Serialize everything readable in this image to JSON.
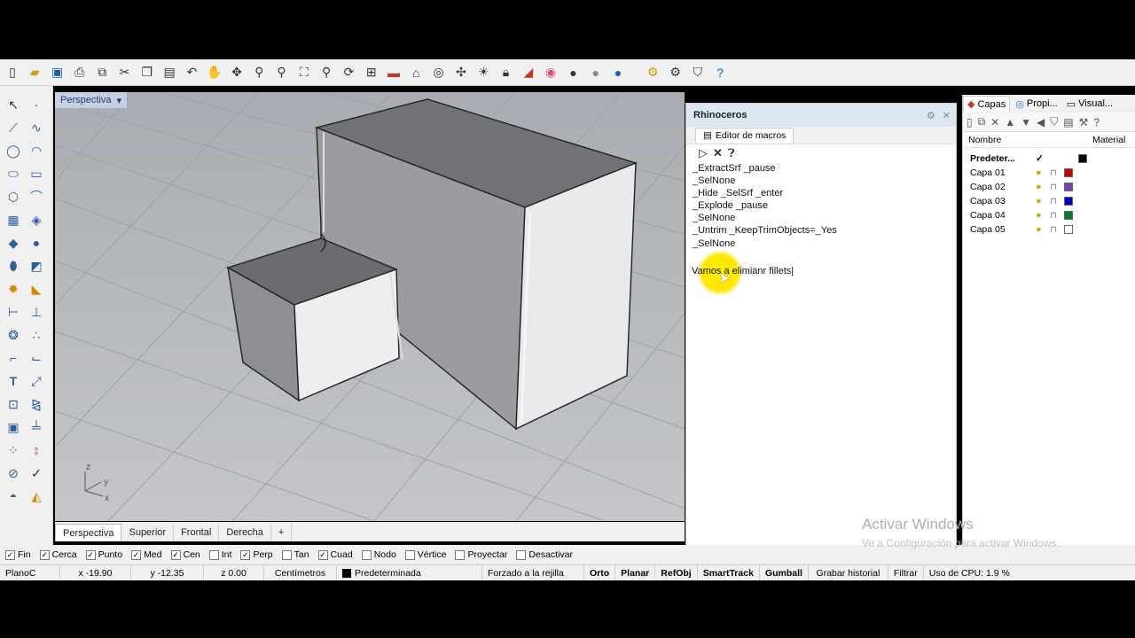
{
  "viewport": {
    "label": "Perspectiva",
    "dropdown": "▾"
  },
  "view_tabs": [
    "Perspectiva",
    "Superior",
    "Frontal",
    "Derecha",
    "+"
  ],
  "axes": {
    "z": "z",
    "y": "y",
    "x": "x"
  },
  "macro_panel": {
    "title": "Rhinoceros",
    "tab": "Editor de macros",
    "lines": [
      "_ExtractSrf _pause",
      "_SelNone",
      "_Hide _SelSrf _enter",
      "_Explode _pause",
      "_SelNone",
      "_Untrim _KeepTrimObjects=_Yes",
      "_SelNone"
    ],
    "note": "Vamos a elimianr fillets|"
  },
  "layers_panel": {
    "tabs": [
      "Capas",
      "Propi...",
      "Visual..."
    ],
    "col_name": "Nombre",
    "col_material": "Material",
    "default_layer": "Predeter...",
    "default_check": "✓",
    "layers": [
      {
        "name": "Capa 01",
        "color": "#cc0000"
      },
      {
        "name": "Capa 02",
        "color": "#7b3fb5"
      },
      {
        "name": "Capa 03",
        "color": "#0000cc"
      },
      {
        "name": "Capa 04",
        "color": "#00802b"
      },
      {
        "name": "Capa 05",
        "color": "#ffffff"
      }
    ]
  },
  "osnap": [
    {
      "label": "Fin",
      "checked": true
    },
    {
      "label": "Cerca",
      "checked": true
    },
    {
      "label": "Punto",
      "checked": true
    },
    {
      "label": "Med",
      "checked": true
    },
    {
      "label": "Cen",
      "checked": true
    },
    {
      "label": "Int",
      "checked": false
    },
    {
      "label": "Perp",
      "checked": true
    },
    {
      "label": "Tan",
      "checked": false
    },
    {
      "label": "Cuad",
      "checked": true
    },
    {
      "label": "Nodo",
      "checked": false
    },
    {
      "label": "Vértice",
      "checked": false
    },
    {
      "label": "Proyectar",
      "checked": false
    },
    {
      "label": "Desactivar",
      "checked": false
    }
  ],
  "status": {
    "plane": "PlanoC",
    "x": "x -19.90",
    "y": "y -12.35",
    "z": "z 0.00",
    "units": "Centímetros",
    "layer": "Predeterminada",
    "grid_snap": "Forzado a la rejilla",
    "ortho": "Orto",
    "planar": "Planar",
    "refobj": "RefObj",
    "smarttrack": "SmartTrack",
    "gumball": "Gumball",
    "history": "Grabar historial",
    "filter": "Filtrar",
    "cpu": "Uso de CPU: 1.9 %"
  },
  "watermark": {
    "line1": "Activar Windows",
    "line2": "Ve a Configuración para activar Windows."
  }
}
